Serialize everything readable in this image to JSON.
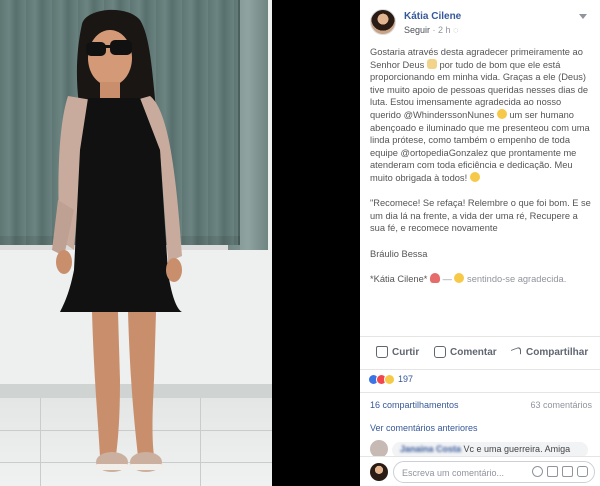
{
  "post": {
    "author": "Kátia Cilene",
    "follow_label": "Seguir",
    "time": "2 h",
    "paragraphs": [
      {
        "parts": [
          "Gostaria através desta agradecer primeiramente ao Senhor Deus",
          " por tudo de bom que ele está proporcionando em minha vida. Graças a ele (Deus) tive muito apoio de pessoas queridas nesses dias de luta. Estou imensamente agradecida ao nosso querido @WhinderssonNunes",
          " um ser humano abençoado e iluminado que me presenteou com uma linda prótese, como também o empenho de toda equipe @ortopediaGonzalez que prontamente me atenderam com toda eficiência e dedicação. Meu muito obrigada à todos! "
        ]
      }
    ],
    "quote": "\"Recomece! Se refaça! Relembre o que foi bom. E se um dia lá na frente, a vida der uma ré, Recupere a sua fé, e recomece novamente",
    "quote_author": "Bráulio Bessa",
    "signature_name": "*Kátia Cilene*",
    "feeling_separator": " — ",
    "feeling": " sentindo-se agradecida."
  },
  "actions": {
    "like": "Curtir",
    "comment": "Comentar",
    "share": "Compartilhar"
  },
  "reactions": {
    "count": "197",
    "types": [
      "like-icon",
      "love-icon",
      "wow-icon"
    ]
  },
  "stats": {
    "shares": "16 compartilhamentos",
    "comments": "63 comentários"
  },
  "comments": {
    "view_previous": "Ver comentários anteriores",
    "preview_name": "Janaina Costa",
    "preview_text": " Vc e uma guerreira. Amiga"
  },
  "compose": {
    "placeholder": "Escreva um comentário..."
  },
  "colors": {
    "link": "#365899",
    "muted": "#90949c",
    "like": "#3b75e5",
    "love": "#f2464f"
  }
}
